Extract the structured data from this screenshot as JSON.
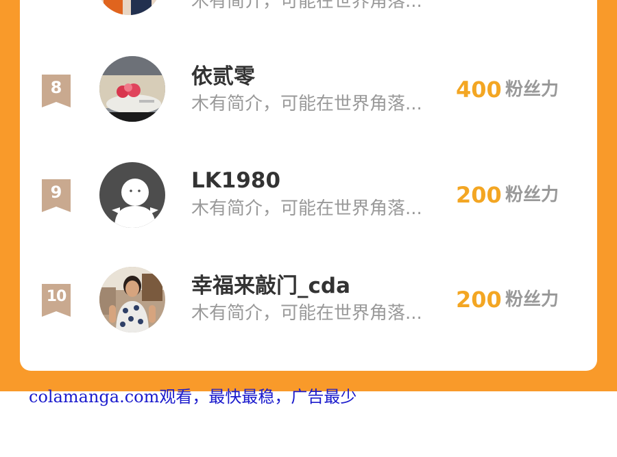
{
  "colors": {
    "page_bg": "#f99a2a",
    "card_bg": "#ffffff",
    "rank_badge": "#c9a98f",
    "score_value": "#f3a623",
    "score_unit": "#999999",
    "name": "#333333",
    "bio": "#999999",
    "footer_link": "#1a1acc"
  },
  "top_partial_row": {
    "bio": "木有简介，可能在世界角落..."
  },
  "leaderboard": [
    {
      "rank": "8",
      "name": "依贰零",
      "bio": "木有简介，可能在世界角落...",
      "score": "400",
      "score_unit": "粉丝力",
      "avatar_icon": "flower-photo-avatar"
    },
    {
      "rank": "9",
      "name": "LK1980",
      "bio": "木有简介，可能在世界角落...",
      "score": "200",
      "score_unit": "粉丝力",
      "avatar_icon": "default-ghost-avatar"
    },
    {
      "rank": "10",
      "name": "幸福来敲门_cda",
      "bio": "木有简介，可能在世界角落...",
      "score": "200",
      "score_unit": "粉丝力",
      "avatar_icon": "person-photo-avatar"
    }
  ],
  "footer": {
    "text": "colamanga.com观看，最快最稳，广告最少"
  }
}
